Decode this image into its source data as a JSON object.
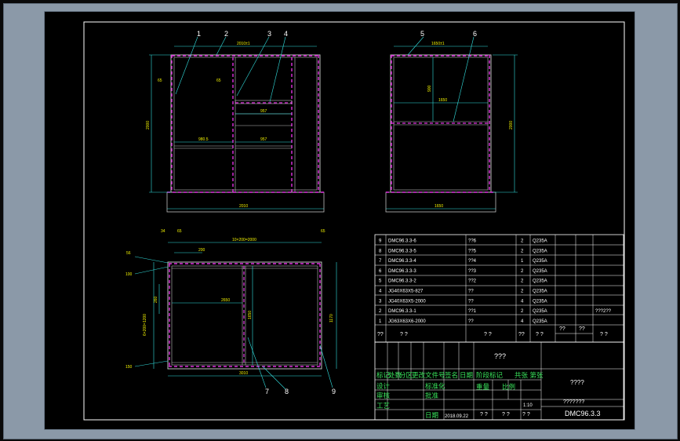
{
  "colors": {
    "border": "#ffffff",
    "magenta": "#e030e0",
    "cyan": "#33e0e0",
    "green": "#38e05a",
    "yellow": "#f2f200",
    "red": "#e03030",
    "gray": "#c0c0c0"
  },
  "front_view": {
    "callouts": [
      "1",
      "2",
      "3",
      "4"
    ],
    "dim_top": "2010±1",
    "dim_height": "2000",
    "dim_width": "2010",
    "dim_small_left": "65",
    "dim_small_mid": "65",
    "dim_cell_1": "980.5",
    "dim_cell_2": "957",
    "dim_cell_3": "957"
  },
  "side_view": {
    "callouts": [
      "5",
      "6"
    ],
    "dim_top": "1650±1",
    "dim_height": "2000",
    "dim_width": "1650",
    "dim_inner_h": "900",
    "dim_inner_w": "1650"
  },
  "plan_view": {
    "callouts": [
      "7",
      "8",
      "9"
    ],
    "dim_top": "10×200=2000",
    "dim_left_a": "34",
    "dim_left_b": "65",
    "dim_200": "200",
    "dim_right_65": "65",
    "dim_mid": "2650",
    "dim_vert_mid": "1650",
    "dim_bottom": "3010",
    "dim_right_h": "1170",
    "dim_r1": "56",
    "dim_r2": "100",
    "dim_r3": "6×200=1200",
    "dim_r4": "260",
    "dim_r5": "150"
  },
  "bom": {
    "rows": [
      {
        "no": "9",
        "code": "DMC96.3.3-6",
        "name": "??6",
        "qty": "2",
        "mat": "Q235A"
      },
      {
        "no": "8",
        "code": "DMC96.3.3-5",
        "name": "??5",
        "qty": "2",
        "mat": "Q235A"
      },
      {
        "no": "7",
        "code": "DMC96.3.3-4",
        "name": "??4",
        "qty": "1",
        "mat": "Q235A"
      },
      {
        "no": "6",
        "code": "DMC96.3.3-3",
        "name": "??3",
        "qty": "2",
        "mat": "Q235A"
      },
      {
        "no": "5",
        "code": "DMC96.3.3-2",
        "name": "??2",
        "qty": "2",
        "mat": "Q235A"
      },
      {
        "no": "4",
        "code": "JG40X63X5-827",
        "name": "??",
        "qty": "2",
        "mat": "Q235A"
      },
      {
        "no": "3",
        "code": "JG40X63X5-2000",
        "name": "??",
        "qty": "4",
        "mat": "Q235A"
      },
      {
        "no": "2",
        "code": "DMC96.3.3-1",
        "name": "??1",
        "qty": "2",
        "mat": "Q235A",
        "note": "???2??"
      },
      {
        "no": "1",
        "code": "JG63X63X6-2000",
        "name": "??",
        "qty": "4",
        "mat": "Q235A"
      }
    ],
    "header": {
      "no": "??",
      "code": "? ?",
      "name": "? ?",
      "qty": "??",
      "mat": "? ?",
      "unit": "??",
      "total": "??",
      "remark": "? ?"
    }
  },
  "title_block": {
    "company": "???",
    "drawing_name": "????",
    "drawing_no": "DMC96.3.3",
    "scale": "1:10",
    "date": "2018.09.22",
    "row1": [
      "标记",
      "处数",
      "分区",
      "更改文件号",
      "签名",
      "日期"
    ],
    "design": "设计",
    "standard": "标准化",
    "check": "审核",
    "craft": "工艺",
    "approve": "批准",
    "date_label": "日期",
    "stage": "阶段标记",
    "weight": "重量",
    "ratio": "比例",
    "sheet": "共张 第张",
    "q7": "???????",
    "q2a": "? ?",
    "q2b": "? ?",
    "q2c": "? ?"
  }
}
